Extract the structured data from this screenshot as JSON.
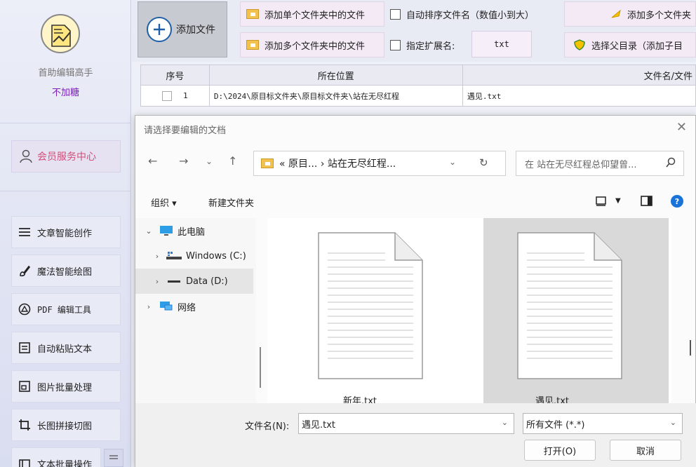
{
  "sidebar": {
    "app_name": "首助编辑高手",
    "app_tag": "不加糖",
    "member": "会员服务中心",
    "items": [
      {
        "label": "文章智能创作",
        "icon": "list-icon"
      },
      {
        "label": "魔法智能绘图",
        "icon": "brush-icon"
      },
      {
        "label": "PDF 编辑工具",
        "icon": "pdf-icon"
      },
      {
        "label": "自动粘贴文本",
        "icon": "paste-icon"
      },
      {
        "label": "图片批量处理",
        "icon": "image-icon"
      },
      {
        "label": "长图拼接切图",
        "icon": "crop-icon"
      },
      {
        "label": "文本批量操作",
        "icon": "text-icon"
      }
    ]
  },
  "toolbar": {
    "add_file": "添加文件",
    "add_single_folder": "添加单个文件夹中的文件",
    "add_multi_folder": "添加多个文件夹中的文件",
    "auto_sort": "自动排序文件名（数值小到大）",
    "specify_ext": "指定扩展名:",
    "ext_value": "txt",
    "add_multi_files": "添加多个文件夹",
    "choose_parent": "选择父目录（添加子目"
  },
  "table": {
    "headers": [
      "序号",
      "所在位置",
      "文件名/文件"
    ],
    "rows": [
      {
        "index": "1",
        "path": "D:\\2024\\原目标文件夹\\原目标文件夹\\站在无尽红程",
        "name": "遇见.txt"
      }
    ]
  },
  "dialog": {
    "title": "请选择要编辑的文档",
    "address": "« 原目... › 站在无尽红程...",
    "search_placeholder": "在 站在无尽红程总仰望曾...",
    "organize": "组织 ▾",
    "new_folder": "新建文件夹",
    "tree": [
      {
        "label": "此电脑",
        "chev": "v"
      },
      {
        "label": "Windows (C:)",
        "chev": ">"
      },
      {
        "label": "Data (D:)",
        "chev": ">"
      },
      {
        "label": "网络",
        "chev": ">"
      }
    ],
    "files": [
      {
        "name": "新年.txt"
      },
      {
        "name": "遇见.txt"
      }
    ],
    "filename_label": "文件名(N):",
    "filename_value": "遇见.txt",
    "filetype": "所有文件 (*.*)",
    "open": "打开(O)",
    "cancel": "取消"
  }
}
